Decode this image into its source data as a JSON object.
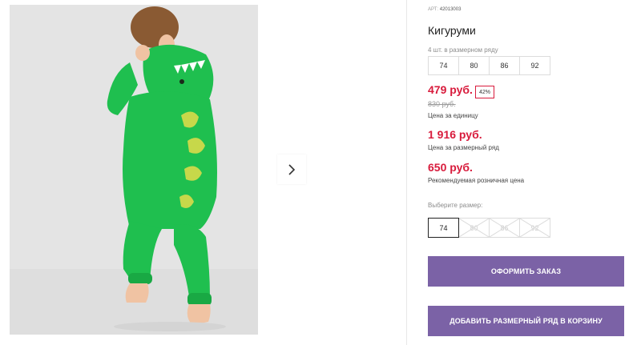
{
  "product": {
    "art_label": "АРТ:",
    "art_value": "42013003",
    "title": "Кигуруми",
    "size_row_note": "4 шт. в размерном ряду",
    "size_row": [
      "74",
      "80",
      "86",
      "92"
    ]
  },
  "prices": {
    "unit_price": "479 руб.",
    "discount": "42%",
    "old_price": "830 руб.",
    "unit_caption": "Цена за единицу",
    "row_price": "1 916 руб.",
    "row_caption": "Цена за размерный ряд",
    "retail_price": "650 руб.",
    "retail_caption": "Рекомендуемая розничная цена"
  },
  "size_picker": {
    "label": "Выберите размер:",
    "options": [
      "74",
      "80",
      "86",
      "92"
    ],
    "selected": "74"
  },
  "buttons": {
    "order": "ОФОРМИТЬ ЗАКАЗ",
    "add_row": "ДОБАВИТЬ РАЗМЕРНЫЙ РЯД В КОРЗИНУ"
  },
  "gallery": {
    "next_icon": "chevron-right-icon"
  },
  "colors": {
    "accent": "#7b62a6",
    "price_red": "#d81b3c",
    "costume_green": "#1fbf4f"
  }
}
